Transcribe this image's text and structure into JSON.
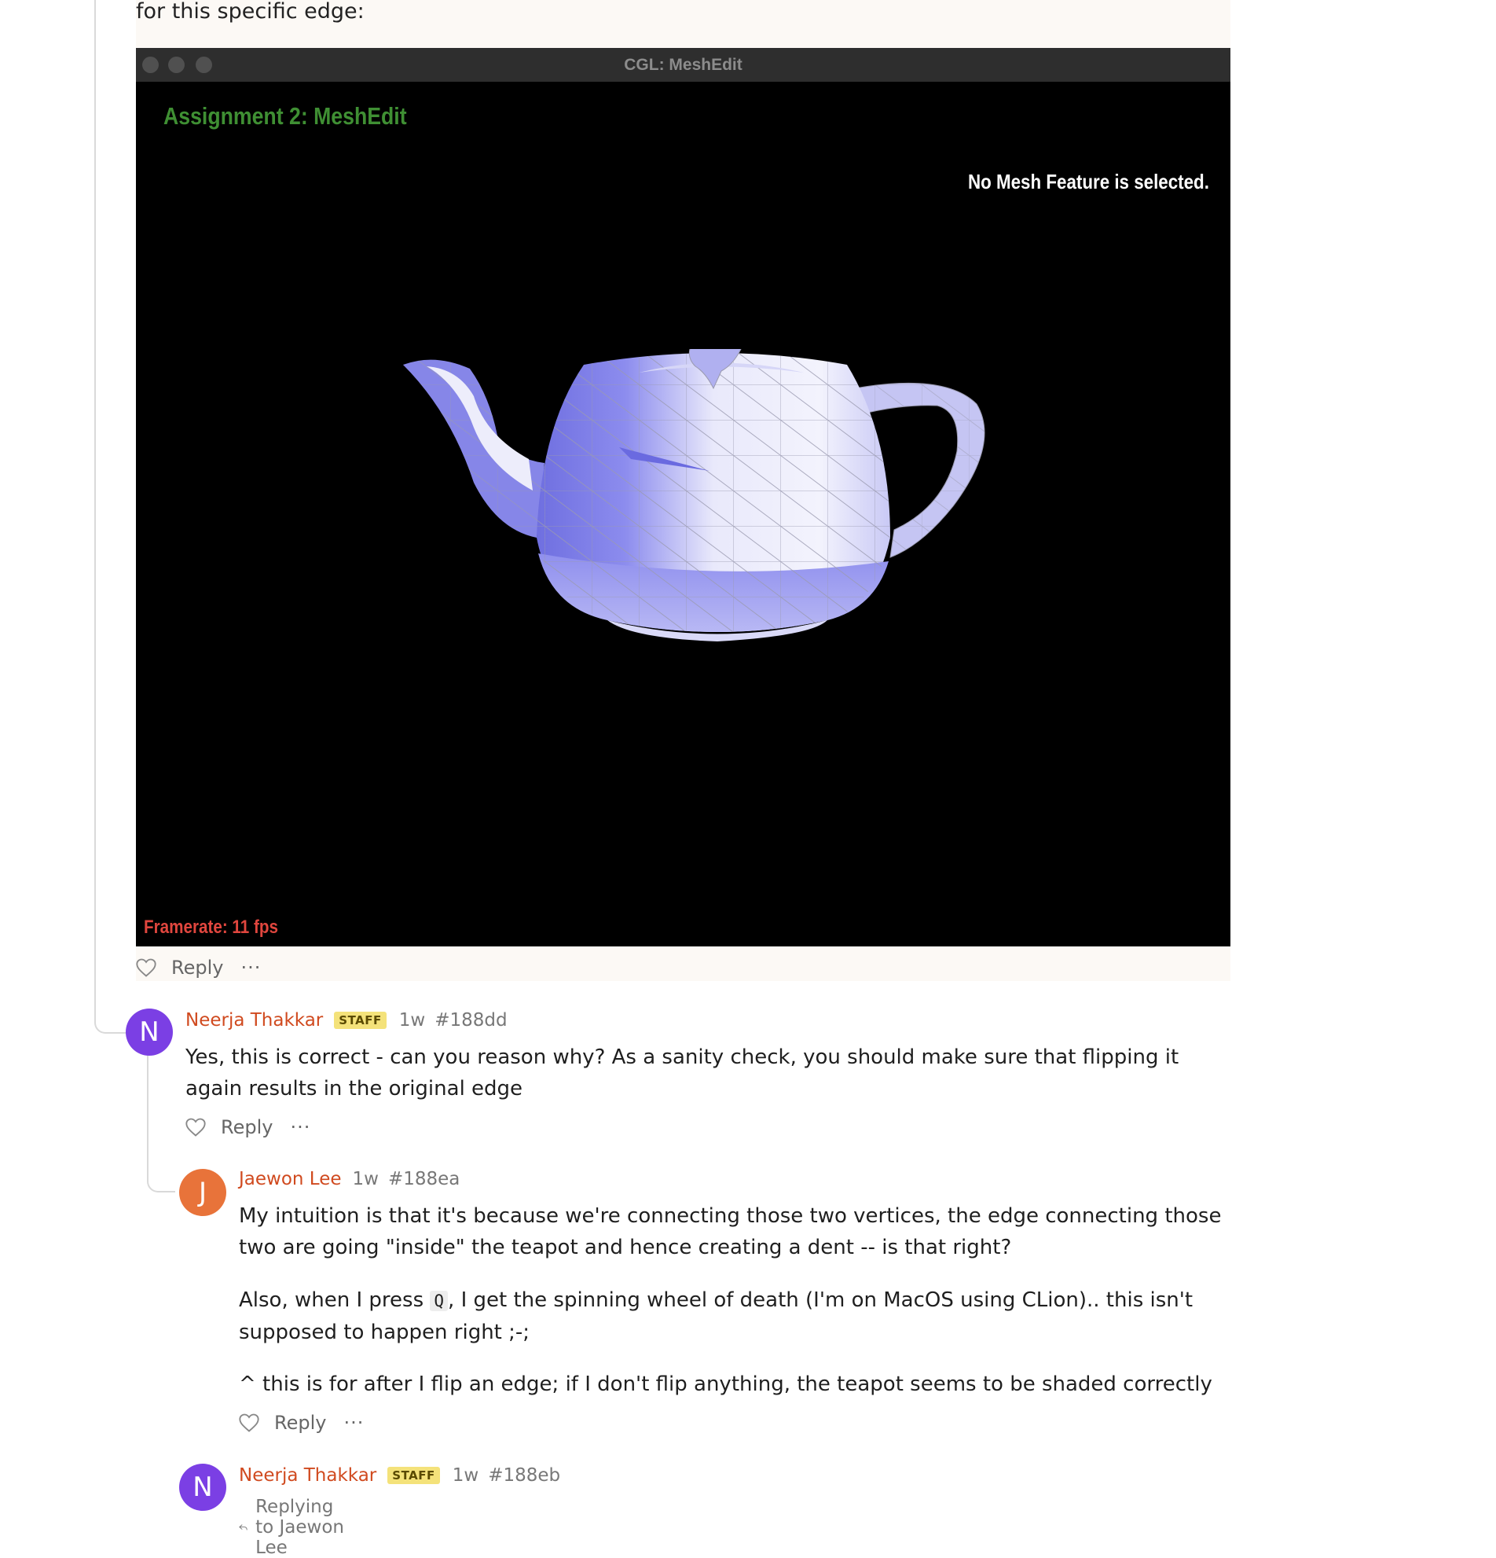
{
  "post": {
    "intro_text": "for this specific edge:",
    "screenshot": {
      "window_title": "CGL: MeshEdit",
      "assignment_title": "Assignment 2: MeshEdit",
      "status_text": "No Mesh Feature is selected.",
      "framerate_text": "Framerate: 11 fps"
    },
    "actions": {
      "reply_label": "Reply",
      "more_label": "···"
    }
  },
  "comments": [
    {
      "avatar_letter": "N",
      "avatar_color": "#7b3fe4",
      "author": "Neerja Thakkar",
      "badge": "STAFF",
      "time": "1w",
      "id": "#188dd",
      "body": "Yes, this is correct - can you reason why? As a sanity check, you should make sure that flipping it again results in the original edge",
      "reply_label": "Reply",
      "more_label": "···"
    },
    {
      "avatar_letter": "J",
      "avatar_color": "#e8733a",
      "author": "Jaewon Lee",
      "time": "1w",
      "id": "#188ea",
      "body_p1": "My intuition is that it's because we're connecting those two vertices, the edge connecting those two are going \"inside\" the teapot and hence creating a dent -- is that right?",
      "body_p2_before": "Also, when I press ",
      "body_p2_code": "Q",
      "body_p2_after": ", I get the spinning wheel of death (I'm on MacOS using CLion).. this isn't supposed to happen right ;-;",
      "body_p3": "^ this is for after I flip an edge; if I don't flip anything, the teapot seems to be shaded correctly",
      "reply_label": "Reply",
      "more_label": "···"
    },
    {
      "avatar_letter": "N",
      "avatar_color": "#7b3fe4",
      "author": "Neerja Thakkar",
      "badge": "STAFF",
      "time": "1w",
      "id": "#188eb",
      "replying_to": "Replying to Jaewon Lee"
    }
  ]
}
